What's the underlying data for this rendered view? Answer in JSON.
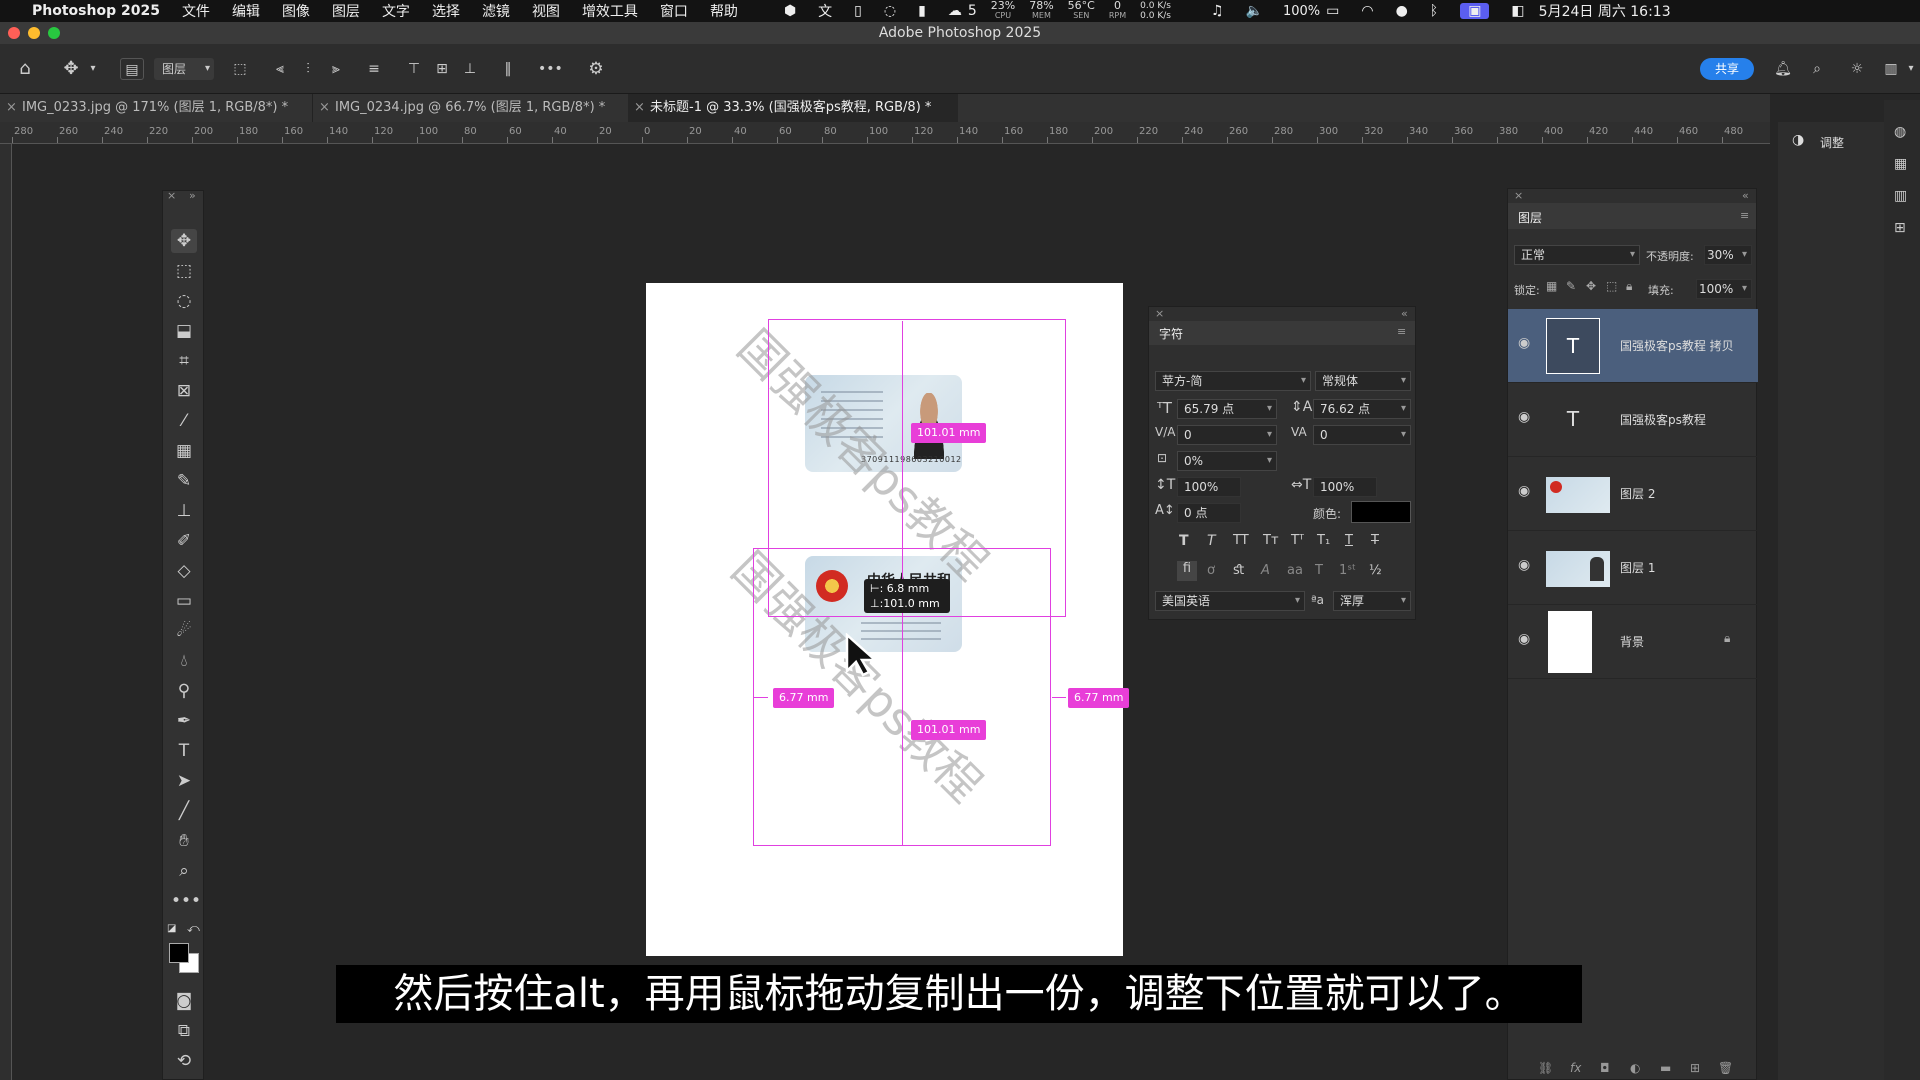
{
  "menubar": {
    "app": "Photoshop 2025",
    "items": [
      "文件",
      "编辑",
      "图像",
      "图层",
      "文字",
      "选择",
      "滤镜",
      "视图",
      "增效工具",
      "窗口",
      "帮助"
    ],
    "wechat_count": "5",
    "cpu": "23%",
    "cpu_label": "CPU",
    "mem": "78%",
    "mem_label": "MEM",
    "sen": "56°C",
    "sen_label": "SEN",
    "rpm": "0",
    "rpm_label": "RPM",
    "net_up": "0.0 K/s",
    "net_down": "0.0 K/s",
    "battery": "100%",
    "datetime": "5月24日 周六 16:13"
  },
  "window": {
    "title": "Adobe Photoshop 2025"
  },
  "options": {
    "target": "图层",
    "share": "共享"
  },
  "tabs": [
    {
      "label": "IMG_0233.jpg @ 171% (图层 1, RGB/8*) *"
    },
    {
      "label": "IMG_0234.jpg @ 66.7% (图层 1, RGB/8*) *"
    },
    {
      "label": "未标题-1 @ 33.3% (国强极客ps教程, RGB/8) *"
    }
  ],
  "ruler": [
    "280",
    "260",
    "240",
    "220",
    "200",
    "180",
    "160",
    "140",
    "120",
    "100",
    "80",
    "60",
    "40",
    "20",
    "0",
    "20",
    "40",
    "60",
    "80",
    "100",
    "120",
    "140",
    "160",
    "180",
    "200",
    "220",
    "240",
    "260",
    "280",
    "300",
    "320",
    "340",
    "360",
    "380",
    "400",
    "420",
    "440",
    "460",
    "480"
  ],
  "canvas": {
    "watermark": "国强极客ps教程",
    "watermark2": "国强极客ps教程",
    "card_number": "370911198603210012",
    "card_back_title1": "中华人民共和国",
    "card_back_title2": "证",
    "measure_w1": "101.01 mm",
    "measure_w2": "101.01 mm",
    "measure_left": "6.77 mm",
    "measure_right": "6.77 mm",
    "tooltip_x": "⊢:  6.8 mm",
    "tooltip_y": "⊥:101.0 mm"
  },
  "char_panel": {
    "title": "字符",
    "font": "苹方-简",
    "style": "常规体",
    "size": "65.79 点",
    "leading": "76.62 点",
    "kerning": "0",
    "tracking": "0",
    "tsume": "0%",
    "vscale": "100%",
    "hscale": "100%",
    "baseline": "0 点",
    "color_label": "颜色:",
    "lang": "美国英语",
    "aa_label": "ªa",
    "aa": "浑厚"
  },
  "layers_panel": {
    "title": "图层",
    "blend": "正常",
    "opacity_label": "不透明度:",
    "opacity": "30%",
    "lock_label": "锁定:",
    "fill_label": "填充:",
    "fill": "100%",
    "layers": [
      {
        "name": "国强极客ps教程 拷贝",
        "kind": "text",
        "selected": true
      },
      {
        "name": "国强极客ps教程",
        "kind": "text"
      },
      {
        "name": "图层 2",
        "kind": "image"
      },
      {
        "name": "图层 1",
        "kind": "image"
      },
      {
        "name": "背景",
        "kind": "background"
      }
    ]
  },
  "adjust": {
    "label": "调整"
  },
  "subtitle": "然后按住alt，再用鼠标拖动复制出一份，调整下位置就可以了。",
  "colors": {
    "accent": "#e83ed8",
    "share": "#2680eb",
    "selected_layer": "#4b5f7d"
  }
}
